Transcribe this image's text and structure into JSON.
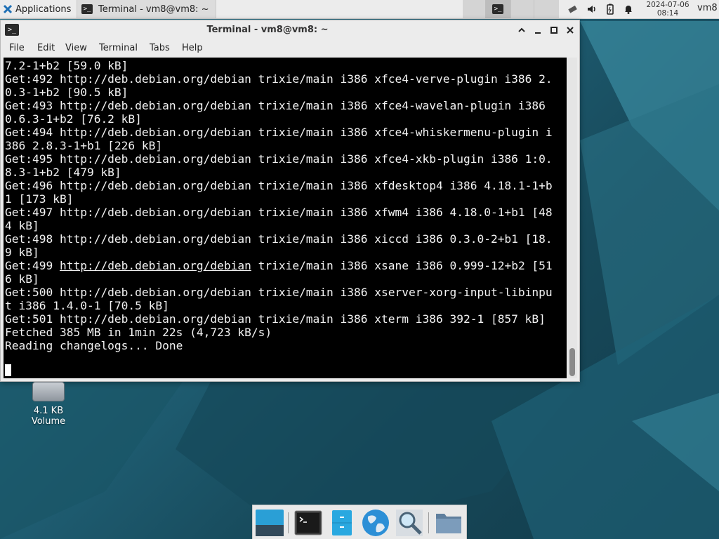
{
  "top_panel": {
    "applications_label": "Applications",
    "task_terminal_label": "Terminal - vm8@vm8: ~",
    "clock_date": "2024-07-06",
    "clock_time": "08:14",
    "user": "vm8"
  },
  "window": {
    "title": "Terminal - vm8@vm8: ~",
    "menu": [
      "File",
      "Edit",
      "View",
      "Terminal",
      "Tabs",
      "Help"
    ]
  },
  "terminal": {
    "lines": [
      "7.2-1+b2 [59.0 kB]",
      "Get:492 http://deb.debian.org/debian trixie/main i386 xfce4-verve-plugin i386 2.",
      "0.3-1+b2 [90.5 kB]",
      "Get:493 http://deb.debian.org/debian trixie/main i386 xfce4-wavelan-plugin i386",
      "0.6.3-1+b2 [76.2 kB]",
      "Get:494 http://deb.debian.org/debian trixie/main i386 xfce4-whiskermenu-plugin i",
      "386 2.8.3-1+b1 [226 kB]",
      "Get:495 http://deb.debian.org/debian trixie/main i386 xfce4-xkb-plugin i386 1:0.",
      "8.3-1+b2 [479 kB]",
      "Get:496 http://deb.debian.org/debian trixie/main i386 xfdesktop4 i386 4.18.1-1+b",
      "1 [173 kB]",
      "Get:497 http://deb.debian.org/debian trixie/main i386 xfwm4 i386 4.18.0-1+b1 [48",
      "4 kB]",
      "Get:498 http://deb.debian.org/debian trixie/main i386 xiccd i386 0.3.0-2+b1 [18.",
      "9 kB]",
      "Get:499 http://deb.debian.org/debian trixie/main i386 xsane i386 0.999-12+b2 [51",
      "6 kB]",
      "Get:500 http://deb.debian.org/debian trixie/main i386 xserver-xorg-input-libinpu",
      "t i386 1.4.0-1 [70.5 kB]",
      "Get:501 http://deb.debian.org/debian trixie/main i386 xterm i386 392-1 [857 kB]",
      "Fetched 385 MB in 1min 22s (4,723 kB/s)",
      "Reading changelogs... Done"
    ]
  },
  "desktop_icon": {
    "line1": "4.1 KB",
    "line2": "Volume"
  },
  "dock": {
    "items": [
      "show-desktop-icon",
      "terminal-icon",
      "file-manager-icon",
      "web-browser-icon",
      "app-finder-icon",
      "folder-icon"
    ]
  },
  "colors": {
    "panel_bg": "#ececec",
    "terminal_bg": "#000000",
    "terminal_fg": "#f2f2f2",
    "desktop_bg": "#1d5a6c"
  }
}
